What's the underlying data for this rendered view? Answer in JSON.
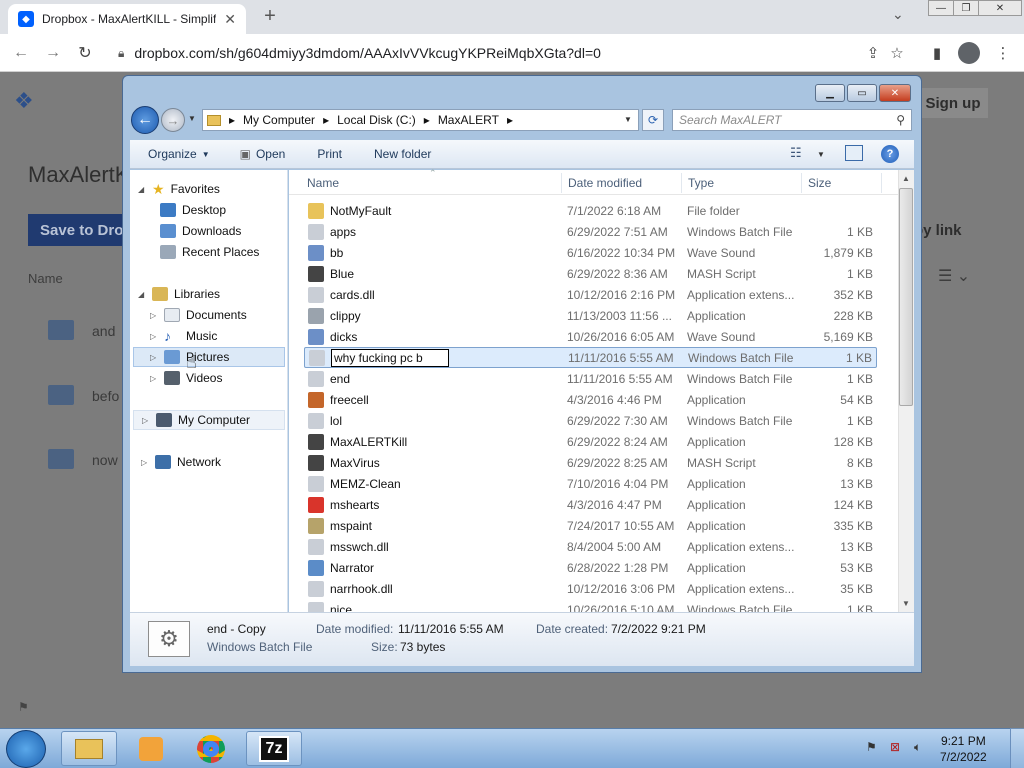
{
  "browser": {
    "tab_title": "Dropbox - MaxAlertKILL - Simplif",
    "url": "dropbox.com/sh/g604dmiyy3dmdom/AAAxIvVVkcugYKPReiMqbXGta?dl=0"
  },
  "dropbox": {
    "signup_label": "Sign up",
    "title": "MaxAlertK",
    "save_label": "Save to Drop",
    "copy_link_label": "py link",
    "name_col": "Name",
    "items": [
      "and",
      "befo",
      "now"
    ]
  },
  "explorer": {
    "breadcrumb": [
      "My Computer",
      "Local Disk (C:)",
      "MaxALERT"
    ],
    "search_placeholder": "Search MaxALERT",
    "commands": [
      "Organize",
      "Open",
      "Print",
      "New folder"
    ],
    "nav": {
      "favorites": "Favorites",
      "favorites_items": [
        "Desktop",
        "Downloads",
        "Recent Places"
      ],
      "libraries": "Libraries",
      "libraries_items": [
        "Documents",
        "Music",
        "Pictures",
        "Videos"
      ],
      "computer": "My Computer",
      "network": "Network"
    },
    "columns": [
      "Name",
      "Date modified",
      "Type",
      "Size"
    ],
    "rename_text": "why fucking pc b",
    "files": [
      {
        "name": "NotMyFault",
        "date": "7/1/2022 6:18 AM",
        "type": "File folder",
        "size": "",
        "icon": "folder-icon",
        "color": "#e8c35a"
      },
      {
        "name": "apps",
        "date": "6/29/2022 7:51 AM",
        "type": "Windows Batch File",
        "size": "1 KB",
        "icon": "batch-file-icon",
        "color": "#c9ced6"
      },
      {
        "name": "bb",
        "date": "6/16/2022 10:34 PM",
        "type": "Wave Sound",
        "size": "1,879 KB",
        "icon": "sound-file-icon",
        "color": "#6c8fc7"
      },
      {
        "name": "Blue",
        "date": "6/29/2022 8:36 AM",
        "type": "MASH Script",
        "size": "1 KB",
        "icon": "mash-script-icon",
        "color": "#444444"
      },
      {
        "name": "cards.dll",
        "date": "10/12/2016 2:16 PM",
        "type": "Application extens...",
        "size": "352 KB",
        "icon": "dll-icon",
        "color": "#c9ced6"
      },
      {
        "name": "clippy",
        "date": "11/13/2003 11:56 ...",
        "type": "Application",
        "size": "228 KB",
        "icon": "clippy-icon",
        "color": "#9aa3ad"
      },
      {
        "name": "dicks",
        "date": "10/26/2016 6:05 AM",
        "type": "Wave Sound",
        "size": "5,169 KB",
        "icon": "sound-file-icon",
        "color": "#6c8fc7"
      },
      {
        "name": "",
        "date": "11/11/2016 5:55 AM",
        "type": "Windows Batch File",
        "size": "1 KB",
        "icon": "batch-file-icon",
        "color": "#c9ced6",
        "renaming": true
      },
      {
        "name": "end",
        "date": "11/11/2016 5:55 AM",
        "type": "Windows Batch File",
        "size": "1 KB",
        "icon": "batch-file-icon",
        "color": "#c9ced6"
      },
      {
        "name": "freecell",
        "date": "4/3/2016 4:46 PM",
        "type": "Application",
        "size": "54 KB",
        "icon": "freecell-icon",
        "color": "#c4662a"
      },
      {
        "name": "lol",
        "date": "6/29/2022 7:30 AM",
        "type": "Windows Batch File",
        "size": "1 KB",
        "icon": "batch-file-icon",
        "color": "#c9ced6"
      },
      {
        "name": "MaxALERTKill",
        "date": "6/29/2022 8:24 AM",
        "type": "Application",
        "size": "128 KB",
        "icon": "app-icon",
        "color": "#444444"
      },
      {
        "name": "MaxVirus",
        "date": "6/29/2022 8:25 AM",
        "type": "MASH Script",
        "size": "8 KB",
        "icon": "mash-script-icon",
        "color": "#444444"
      },
      {
        "name": "MEMZ-Clean",
        "date": "7/10/2016 4:04 PM",
        "type": "Application",
        "size": "13 KB",
        "icon": "app-icon",
        "color": "#c9ced6"
      },
      {
        "name": "mshearts",
        "date": "4/3/2016 4:47 PM",
        "type": "Application",
        "size": "124 KB",
        "icon": "hearts-icon",
        "color": "#d9342b"
      },
      {
        "name": "mspaint",
        "date": "7/24/2017 10:55 AM",
        "type": "Application",
        "size": "335 KB",
        "icon": "paint-icon",
        "color": "#b6a36a"
      },
      {
        "name": "msswch.dll",
        "date": "8/4/2004 5:00 AM",
        "type": "Application extens...",
        "size": "13 KB",
        "icon": "dll-icon",
        "color": "#c9ced6"
      },
      {
        "name": "Narrator",
        "date": "6/28/2022 1:28 PM",
        "type": "Application",
        "size": "53 KB",
        "icon": "narrator-icon",
        "color": "#5b8cc8"
      },
      {
        "name": "narrhook.dll",
        "date": "10/12/2016 3:06 PM",
        "type": "Application extens...",
        "size": "35 KB",
        "icon": "dll-icon",
        "color": "#c9ced6"
      },
      {
        "name": "nice",
        "date": "10/26/2016 5:10 AM",
        "type": "Windows Batch File",
        "size": "1 KB",
        "icon": "batch-file-icon",
        "color": "#c9ced6"
      }
    ],
    "details": {
      "name": "end - Copy",
      "type": "Windows Batch File",
      "modified_label": "Date modified:",
      "modified": "11/11/2016 5:55 AM",
      "created_label": "Date created:",
      "created": "7/2/2022 9:21 PM",
      "size_label": "Size:",
      "size": "73 bytes"
    }
  },
  "taskbar": {
    "time": "9:21 PM",
    "date": "7/2/2022",
    "sevenzip_label": "7z"
  }
}
